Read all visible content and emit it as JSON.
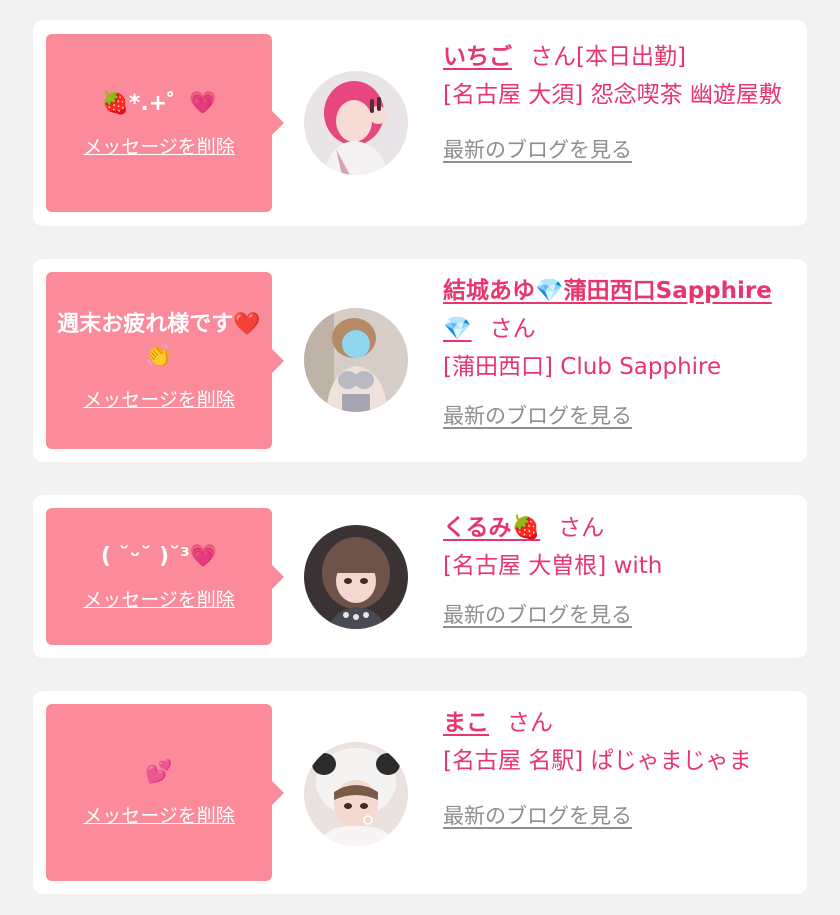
{
  "theme": {
    "background": "#f2f2f2",
    "card": "#ffffff",
    "bubble": "#fb8a9a",
    "accent": "#e8356d",
    "link_gray": "#8e8e8e"
  },
  "messages": [
    {
      "message": "🍓*.+゜💗",
      "delete_label": "メッセージを削除",
      "name": "いちご",
      "honorific": "さん",
      "status": "[本日出勤]",
      "shop": "[名古屋 大須] 怨念喫茶 幽遊屋敷",
      "blog_label": "最新のブログを見る",
      "avatar_icon": "profile-photo-pink-hair"
    },
    {
      "message": "週末お疲れ様です❤️👏",
      "delete_label": "メッセージを削除",
      "name": "結城あゆ💎蒲田西口Sapphire💎",
      "honorific": "さん",
      "status": "",
      "shop": "[蒲田西口] Club Sapphire",
      "blog_label": "最新のブログを見る",
      "avatar_icon": "profile-photo-silver-outfit"
    },
    {
      "message": "( ˘ᵕ˘ )˘³💗",
      "delete_label": "メッセージを削除",
      "name": "くるみ🍓",
      "honorific": "さん",
      "status": "",
      "shop": "[名古屋 大曽根] with",
      "blog_label": "最新のブログを見る",
      "avatar_icon": "profile-photo-brown-hair"
    },
    {
      "message": "💕",
      "delete_label": "メッセージを削除",
      "name": "まこ",
      "honorific": "さん",
      "status": "",
      "shop": "[名古屋 名駅] ぱじゃまじゃま",
      "blog_label": "最新のブログを見る",
      "avatar_icon": "profile-photo-panda-hood"
    }
  ]
}
